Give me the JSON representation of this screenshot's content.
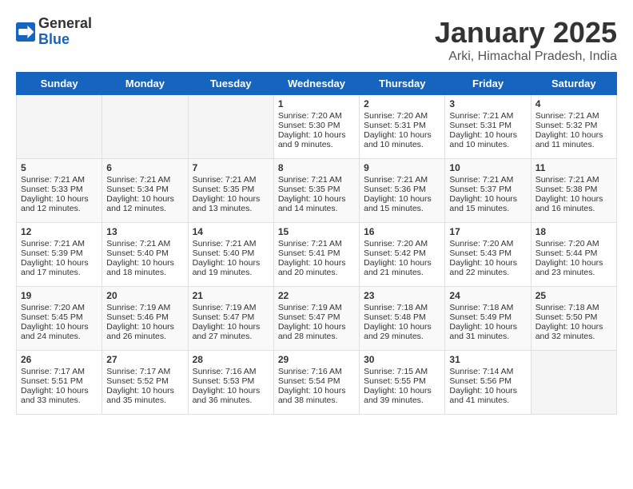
{
  "header": {
    "logo_general": "General",
    "logo_blue": "Blue",
    "month": "January 2025",
    "location": "Arki, Himachal Pradesh, India"
  },
  "days_of_week": [
    "Sunday",
    "Monday",
    "Tuesday",
    "Wednesday",
    "Thursday",
    "Friday",
    "Saturday"
  ],
  "weeks": [
    [
      {
        "day": "",
        "content": ""
      },
      {
        "day": "",
        "content": ""
      },
      {
        "day": "",
        "content": ""
      },
      {
        "day": "1",
        "content": "Sunrise: 7:20 AM\nSunset: 5:30 PM\nDaylight: 10 hours\nand 9 minutes."
      },
      {
        "day": "2",
        "content": "Sunrise: 7:20 AM\nSunset: 5:31 PM\nDaylight: 10 hours\nand 10 minutes."
      },
      {
        "day": "3",
        "content": "Sunrise: 7:21 AM\nSunset: 5:31 PM\nDaylight: 10 hours\nand 10 minutes."
      },
      {
        "day": "4",
        "content": "Sunrise: 7:21 AM\nSunset: 5:32 PM\nDaylight: 10 hours\nand 11 minutes."
      }
    ],
    [
      {
        "day": "5",
        "content": "Sunrise: 7:21 AM\nSunset: 5:33 PM\nDaylight: 10 hours\nand 12 minutes."
      },
      {
        "day": "6",
        "content": "Sunrise: 7:21 AM\nSunset: 5:34 PM\nDaylight: 10 hours\nand 12 minutes."
      },
      {
        "day": "7",
        "content": "Sunrise: 7:21 AM\nSunset: 5:35 PM\nDaylight: 10 hours\nand 13 minutes."
      },
      {
        "day": "8",
        "content": "Sunrise: 7:21 AM\nSunset: 5:35 PM\nDaylight: 10 hours\nand 14 minutes."
      },
      {
        "day": "9",
        "content": "Sunrise: 7:21 AM\nSunset: 5:36 PM\nDaylight: 10 hours\nand 15 minutes."
      },
      {
        "day": "10",
        "content": "Sunrise: 7:21 AM\nSunset: 5:37 PM\nDaylight: 10 hours\nand 15 minutes."
      },
      {
        "day": "11",
        "content": "Sunrise: 7:21 AM\nSunset: 5:38 PM\nDaylight: 10 hours\nand 16 minutes."
      }
    ],
    [
      {
        "day": "12",
        "content": "Sunrise: 7:21 AM\nSunset: 5:39 PM\nDaylight: 10 hours\nand 17 minutes."
      },
      {
        "day": "13",
        "content": "Sunrise: 7:21 AM\nSunset: 5:40 PM\nDaylight: 10 hours\nand 18 minutes."
      },
      {
        "day": "14",
        "content": "Sunrise: 7:21 AM\nSunset: 5:40 PM\nDaylight: 10 hours\nand 19 minutes."
      },
      {
        "day": "15",
        "content": "Sunrise: 7:21 AM\nSunset: 5:41 PM\nDaylight: 10 hours\nand 20 minutes."
      },
      {
        "day": "16",
        "content": "Sunrise: 7:20 AM\nSunset: 5:42 PM\nDaylight: 10 hours\nand 21 minutes."
      },
      {
        "day": "17",
        "content": "Sunrise: 7:20 AM\nSunset: 5:43 PM\nDaylight: 10 hours\nand 22 minutes."
      },
      {
        "day": "18",
        "content": "Sunrise: 7:20 AM\nSunset: 5:44 PM\nDaylight: 10 hours\nand 23 minutes."
      }
    ],
    [
      {
        "day": "19",
        "content": "Sunrise: 7:20 AM\nSunset: 5:45 PM\nDaylight: 10 hours\nand 24 minutes."
      },
      {
        "day": "20",
        "content": "Sunrise: 7:19 AM\nSunset: 5:46 PM\nDaylight: 10 hours\nand 26 minutes."
      },
      {
        "day": "21",
        "content": "Sunrise: 7:19 AM\nSunset: 5:47 PM\nDaylight: 10 hours\nand 27 minutes."
      },
      {
        "day": "22",
        "content": "Sunrise: 7:19 AM\nSunset: 5:47 PM\nDaylight: 10 hours\nand 28 minutes."
      },
      {
        "day": "23",
        "content": "Sunrise: 7:18 AM\nSunset: 5:48 PM\nDaylight: 10 hours\nand 29 minutes."
      },
      {
        "day": "24",
        "content": "Sunrise: 7:18 AM\nSunset: 5:49 PM\nDaylight: 10 hours\nand 31 minutes."
      },
      {
        "day": "25",
        "content": "Sunrise: 7:18 AM\nSunset: 5:50 PM\nDaylight: 10 hours\nand 32 minutes."
      }
    ],
    [
      {
        "day": "26",
        "content": "Sunrise: 7:17 AM\nSunset: 5:51 PM\nDaylight: 10 hours\nand 33 minutes."
      },
      {
        "day": "27",
        "content": "Sunrise: 7:17 AM\nSunset: 5:52 PM\nDaylight: 10 hours\nand 35 minutes."
      },
      {
        "day": "28",
        "content": "Sunrise: 7:16 AM\nSunset: 5:53 PM\nDaylight: 10 hours\nand 36 minutes."
      },
      {
        "day": "29",
        "content": "Sunrise: 7:16 AM\nSunset: 5:54 PM\nDaylight: 10 hours\nand 38 minutes."
      },
      {
        "day": "30",
        "content": "Sunrise: 7:15 AM\nSunset: 5:55 PM\nDaylight: 10 hours\nand 39 minutes."
      },
      {
        "day": "31",
        "content": "Sunrise: 7:14 AM\nSunset: 5:56 PM\nDaylight: 10 hours\nand 41 minutes."
      },
      {
        "day": "",
        "content": ""
      }
    ]
  ]
}
